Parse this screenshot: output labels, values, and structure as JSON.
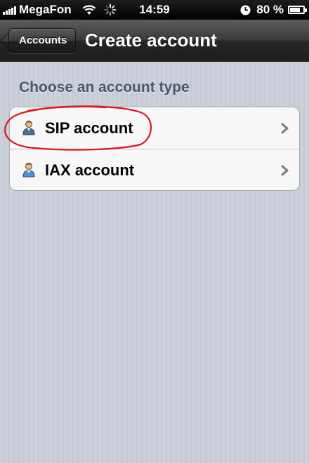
{
  "status_bar": {
    "carrier": "MegaFon",
    "time": "14:59",
    "battery_percent": "80 %",
    "battery_level": 0.8,
    "icons": [
      "signal-icon",
      "wifi-icon",
      "activity-spinner-icon",
      "clock-icon",
      "battery-icon"
    ]
  },
  "nav": {
    "back_label": "Accounts",
    "title": "Create account"
  },
  "section": {
    "header": "Choose an account type",
    "items": [
      {
        "label": "SIP account",
        "icon": "user-icon"
      },
      {
        "label": "IAX account",
        "icon": "user-icon"
      }
    ]
  },
  "colors": {
    "annotation": "#e0141e",
    "section_header": "#4c566c"
  }
}
